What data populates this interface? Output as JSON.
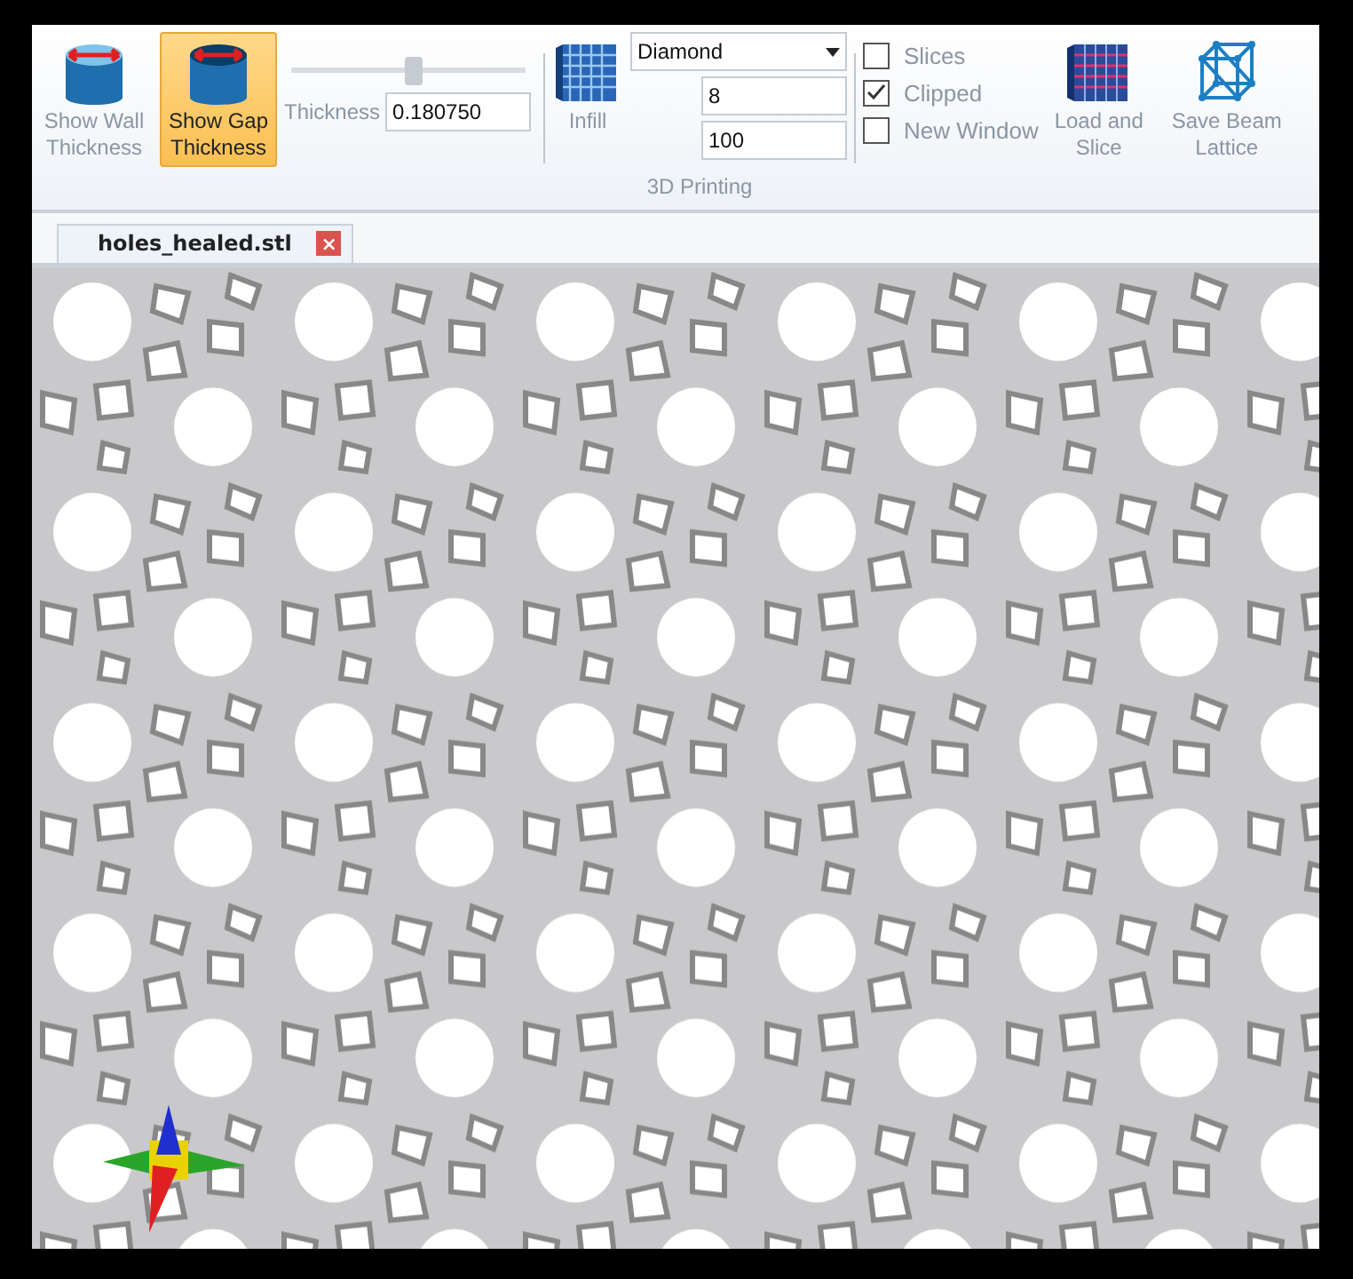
{
  "ribbon": {
    "buttons": [
      {
        "kind": "wall",
        "label": "Show Wall Thickness",
        "selected": false
      },
      {
        "kind": "gap",
        "label": "Show Gap Thickness",
        "selected": true
      }
    ],
    "thickness": {
      "label": "Thickness",
      "value": "0.180750",
      "level": 0.52
    },
    "printing": {
      "infill_label": "Infill",
      "pattern": "Diamond",
      "field_1": "8",
      "field_2": "100",
      "group_label": "3D Printing"
    },
    "checkboxes": [
      {
        "label": "Slices",
        "checked": false
      },
      {
        "label": "Clipped",
        "checked": true
      },
      {
        "label": "New Window",
        "checked": false
      }
    ],
    "actions": [
      {
        "kind": "slice",
        "label": "Load and Slice"
      },
      {
        "kind": "lattice",
        "label": "Save Beam Lattice"
      }
    ]
  },
  "tabs": [
    {
      "label": "holes_healed.stl",
      "selected": true,
      "close": "×"
    }
  ]
}
